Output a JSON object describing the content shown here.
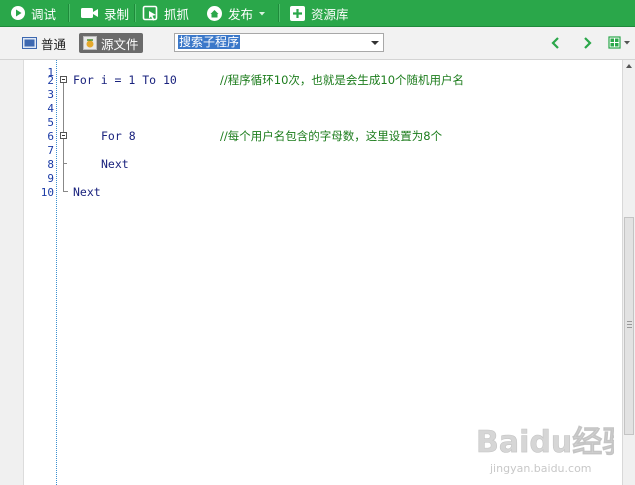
{
  "toolbar": {
    "debug_label": "调试",
    "record_label": "录制",
    "capture_label": "抓抓",
    "publish_label": "发布",
    "resources_label": "资源库"
  },
  "subbar": {
    "normal_label": "普通",
    "source_label": "源文件",
    "search_value": "搜索子程序"
  },
  "editor": {
    "line_numbers": [
      "1",
      "2",
      "3",
      "4",
      "5",
      "6",
      "7",
      "8",
      "9",
      "10"
    ],
    "line2_code": "For i = 1 To 10",
    "line2_comment": "//程序循环10次，也就是会生成10个随机用户名",
    "line6_code": "For 8",
    "line6_comment": "//每个用户名包含的字母数，这里设置为8个",
    "line8_code": "Next",
    "line10_code": "Next"
  },
  "watermark": {
    "brand_text": "Baidu经验",
    "url_text": "jingyan.baidu.com"
  },
  "colors": {
    "toolbar_green": "#2aa74a",
    "code_blue": "#1a237e",
    "comment_green": "#1c7c1c",
    "selection_blue": "#3b78c9"
  }
}
